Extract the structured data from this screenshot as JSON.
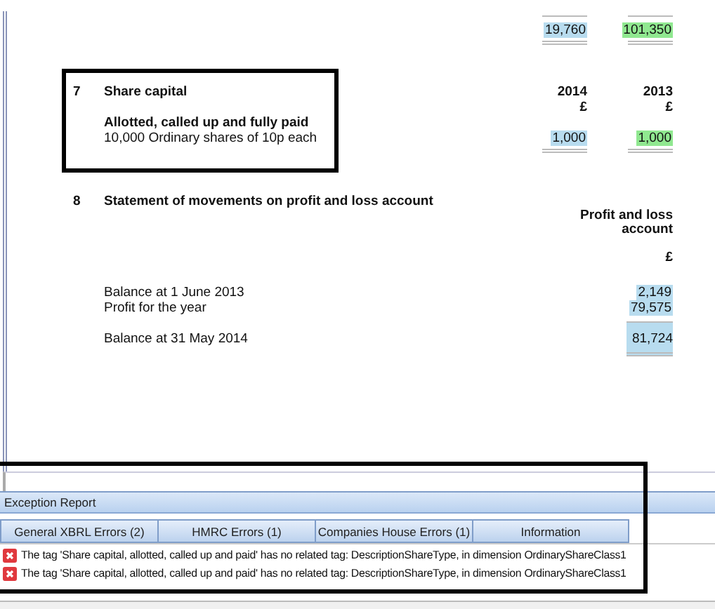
{
  "document": {
    "total_row": {
      "values": [
        {
          "text": "19,760",
          "color": "#b8dcef"
        },
        {
          "text": "101,350",
          "color": "#90e890"
        }
      ]
    },
    "note7": {
      "number": "7",
      "title": "Share capital",
      "headers": [
        {
          "year": "2014",
          "unit": "£"
        },
        {
          "year": "2013",
          "unit": "£"
        }
      ],
      "subtitle": "Allotted, called up and fully paid",
      "line": "10,000 Ordinary shares of 10p each",
      "values": [
        {
          "text": "1,000",
          "color": "#b8dcef"
        },
        {
          "text": "1,000",
          "color": "#90e890"
        }
      ]
    },
    "note8": {
      "number": "8",
      "title": "Statement of movements on profit and loss account",
      "column_heading": [
        "Profit and loss",
        "account"
      ],
      "unit": "£",
      "rows": [
        {
          "label": "Balance at 1 June 2013",
          "value": "2,149",
          "color": "#b8dcef",
          "total": false
        },
        {
          "label": "Profit for the year",
          "value": "79,575",
          "color": "#b8dcef",
          "total": false
        },
        {
          "label": "Balance at 31 May 2014",
          "value": "81,724",
          "color": "#b8dcef",
          "total": true
        }
      ]
    }
  },
  "exception_report": {
    "title": "Exception Report",
    "tabs": [
      {
        "label": "General XBRL Errors (2)",
        "selected": false
      },
      {
        "label": "HMRC Errors (1)",
        "selected": false
      },
      {
        "label": "Companies House Errors (1)",
        "selected": false
      },
      {
        "label": "Information",
        "selected": false
      }
    ],
    "errors": [
      "The tag 'Share capital, allotted, called up and paid' has no related tag: DescriptionShareType, in dimension OrdinaryShareClass1",
      "The tag 'Share capital, allotted, called up and paid' has no related tag: DescriptionShareType, in dimension OrdinaryShareClass1"
    ]
  }
}
